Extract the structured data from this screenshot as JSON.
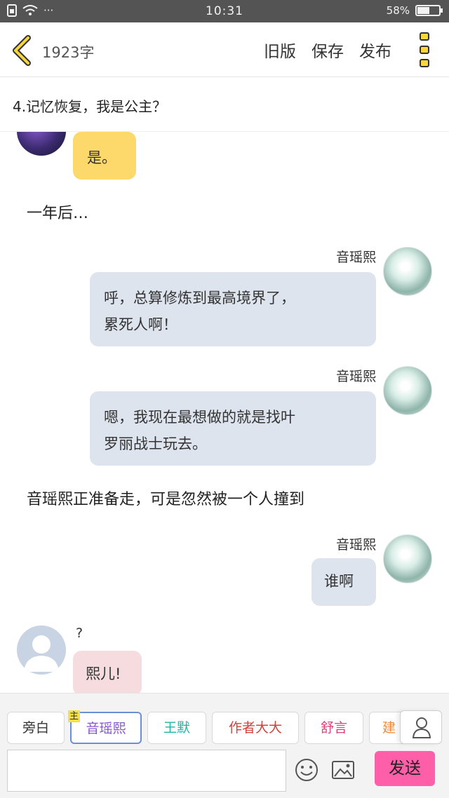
{
  "status_bar": {
    "time": "10:31",
    "battery": "58%",
    "battery_level": 0.58,
    "signal_dots": "···"
  },
  "header": {
    "word_count": "1923字",
    "actions": [
      "旧版",
      "保存",
      "发布"
    ]
  },
  "chapter": {
    "title": "4.记忆恢复，我是公主？"
  },
  "messages": {
    "m1": {
      "text": "是。"
    },
    "narration1": "一年后…",
    "m2": {
      "speaker": "音瑶熙",
      "line1": "呼，总算修炼到最高境界了，",
      "line2": "累死人啊！"
    },
    "m3": {
      "speaker": "音瑶熙",
      "line1": "嗯，我现在最想做的就是找叶",
      "line2": "罗丽战士玩去。"
    },
    "narration2": "音瑶熙正准备走，可是忽然被一个人撞到",
    "m4": {
      "speaker": "音瑶熙",
      "text": "谁啊"
    },
    "m5": {
      "speaker": "?",
      "text": "熙儿!"
    }
  },
  "characters": [
    {
      "label": "旁白",
      "color": "#333333"
    },
    {
      "label": "音瑶熙",
      "color": "#8a56d6",
      "badge": "主"
    },
    {
      "label": "王默",
      "color": "#20b3a6"
    },
    {
      "label": "作者大大",
      "color": "#d4413a"
    },
    {
      "label": "舒言",
      "color": "#e0417a"
    },
    {
      "label": "建",
      "color": "#f08a3a"
    }
  ],
  "composer": {
    "send_label": "发送",
    "input_value": ""
  },
  "colors": {
    "accent_send": "#ff5ea8",
    "bubble_yellow": "#fcd96a",
    "bubble_blue": "#dde4ee",
    "bubble_pink": "#f6dcdf"
  }
}
